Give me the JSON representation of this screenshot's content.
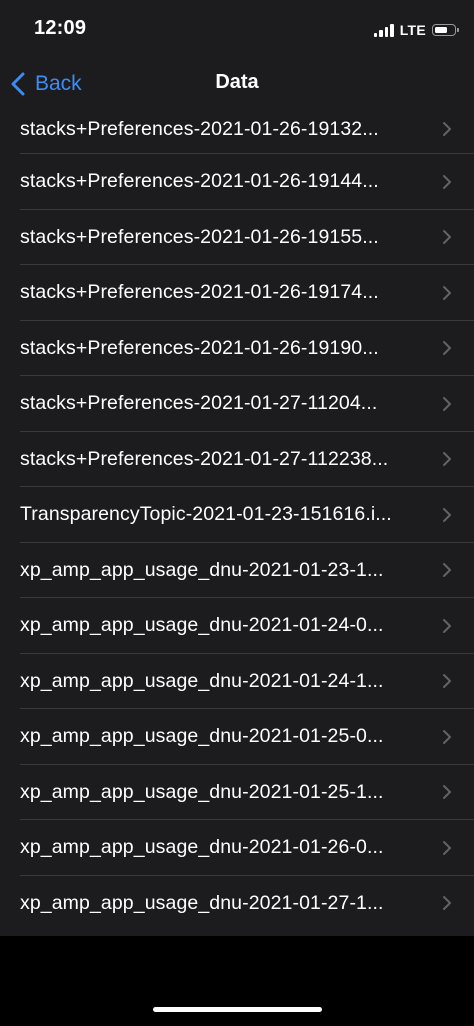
{
  "status_bar": {
    "time": "12:09",
    "network": "LTE",
    "battery_level": 0.7
  },
  "nav": {
    "back_label": "Back",
    "title": "Data"
  },
  "colors": {
    "accent": "#3b8cf3",
    "background": "#1c1c1e",
    "separator": "#3a3a3c",
    "chevron": "#636366"
  },
  "icons": {
    "back": "chevron-left-icon",
    "disclosure": "chevron-right-icon",
    "signal": "cellular-signal-icon",
    "battery": "battery-icon"
  },
  "files": [
    "stacks+Preferences-2021-01-26-19132...",
    "stacks+Preferences-2021-01-26-19144...",
    "stacks+Preferences-2021-01-26-19155...",
    "stacks+Preferences-2021-01-26-19174...",
    "stacks+Preferences-2021-01-26-19190...",
    "stacks+Preferences-2021-01-27-11204...",
    "stacks+Preferences-2021-01-27-112238...",
    "TransparencyTopic-2021-01-23-151616.i...",
    "xp_amp_app_usage_dnu-2021-01-23-1...",
    "xp_amp_app_usage_dnu-2021-01-24-0...",
    "xp_amp_app_usage_dnu-2021-01-24-1...",
    "xp_amp_app_usage_dnu-2021-01-25-0...",
    "xp_amp_app_usage_dnu-2021-01-25-1...",
    "xp_amp_app_usage_dnu-2021-01-26-0...",
    "xp_amp_app_usage_dnu-2021-01-27-1..."
  ]
}
